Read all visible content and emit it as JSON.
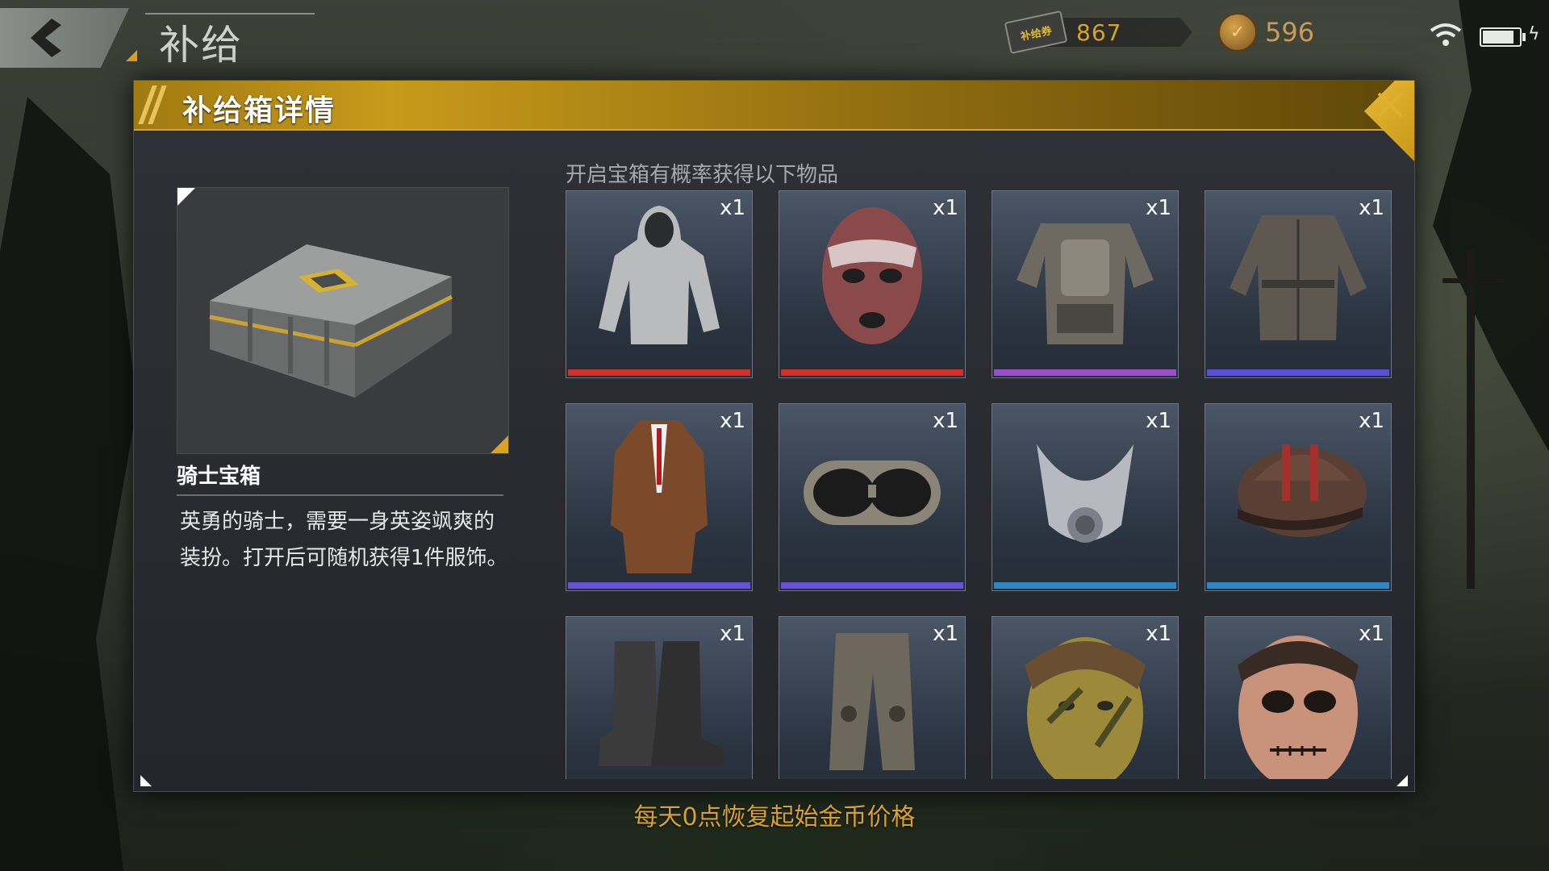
{
  "topbar": {
    "page_title": "补给",
    "ticket_icon_text": "补给券",
    "ticket_count": "867",
    "coin_count": "596"
  },
  "dialog": {
    "title": "补给箱详情",
    "box_name": "骑士宝箱",
    "box_description": "英勇的骑士，需要一身英姿飒爽的装扮。打开后可随机获得1件服饰。",
    "grid_label": "开启宝箱有概率获得以下物品",
    "items": [
      {
        "name": "hooded-jacket",
        "qty": "x1",
        "rarity_color": "#d4302a"
      },
      {
        "name": "balaclava-mask",
        "qty": "x1",
        "rarity_color": "#d4302a"
      },
      {
        "name": "armored-chestpiece",
        "qty": "x1",
        "rarity_color": "#9b4ec9"
      },
      {
        "name": "leather-jacket",
        "qty": "x1",
        "rarity_color": "#5a4fd8"
      },
      {
        "name": "trench-coat",
        "qty": "x1",
        "rarity_color": "#6a4fd8"
      },
      {
        "name": "goggles",
        "qty": "x1",
        "rarity_color": "#6a4fd8"
      },
      {
        "name": "respirator-mask",
        "qty": "x1",
        "rarity_color": "#2f86c4"
      },
      {
        "name": "flat-cap",
        "qty": "x1",
        "rarity_color": "#2f86c4"
      },
      {
        "name": "leather-boots",
        "qty": "x1",
        "rarity_color": ""
      },
      {
        "name": "camo-pants",
        "qty": "x1",
        "rarity_color": ""
      },
      {
        "name": "face-paint-tiger",
        "qty": "x1",
        "rarity_color": ""
      },
      {
        "name": "face-paint-skull",
        "qty": "x1",
        "rarity_color": ""
      }
    ]
  },
  "footer_note": "每天0点恢复起始金币价格",
  "colors": {
    "accent_gold": "#d9a320",
    "header_gold": "#c89a1a",
    "currency_text": "#d7a52c"
  }
}
